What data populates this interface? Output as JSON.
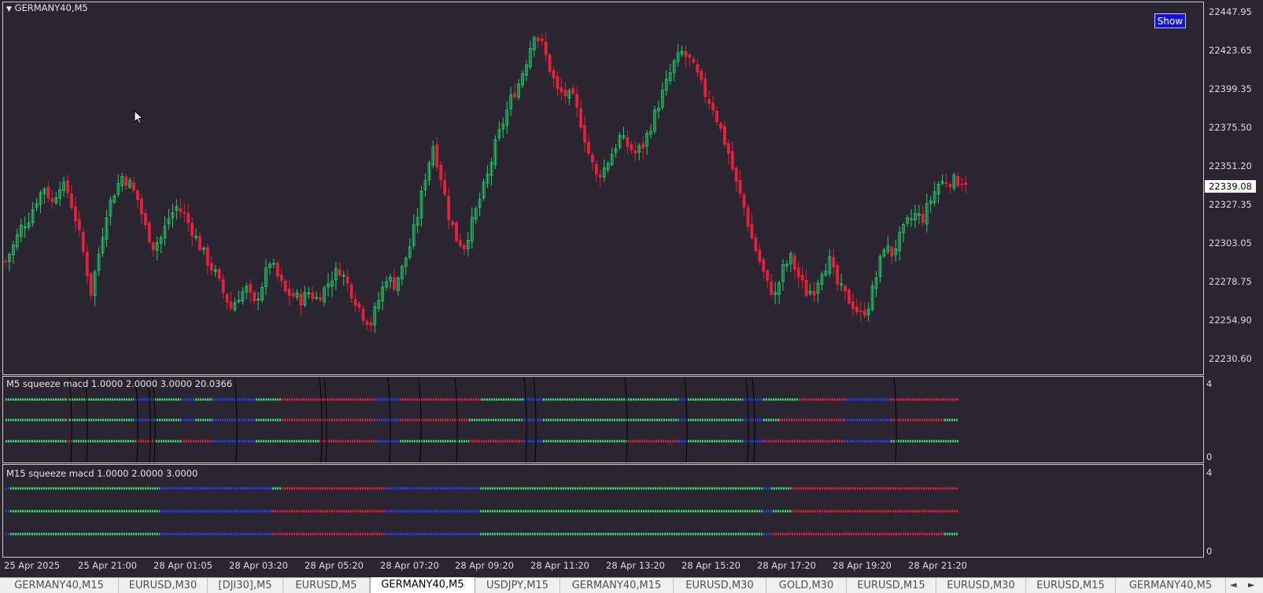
{
  "main_pane": {
    "symbol_label": "GERMANY40,M5",
    "show_button": "Show",
    "current_price": "22339.08",
    "price_labels": [
      "22447.95",
      "22423.65",
      "22399.35",
      "22375.50",
      "22351.20",
      "22327.35",
      "22303.05",
      "22278.75",
      "22254.90",
      "22230.60"
    ]
  },
  "indicator_m5": {
    "label": "M5 squeeze macd 1.0000 2.0000 3.0000 20.0366",
    "axis_max": "4",
    "axis_min": "0"
  },
  "indicator_m15": {
    "label": "M15 squeeze macd 1.0000 2.0000 3.0000",
    "axis_max": "4",
    "axis_min": "0"
  },
  "time_axis": [
    "25 Apr 2025",
    "25 Apr 21:00",
    "28 Apr 01:05",
    "28 Apr 03:20",
    "28 Apr 05:20",
    "28 Apr 07:20",
    "28 Apr 09:20",
    "28 Apr 11:20",
    "28 Apr 13:20",
    "28 Apr 15:20",
    "28 Apr 17:20",
    "28 Apr 19:20",
    "28 Apr 21:20"
  ],
  "tabs": [
    {
      "label": "GERMANY40,M15",
      "active": false
    },
    {
      "label": "EURUSD,M30",
      "active": false
    },
    {
      "label": "[DJI30],M5",
      "active": false
    },
    {
      "label": "EURUSD,M5",
      "active": false
    },
    {
      "label": "GERMANY40,M5",
      "active": true
    },
    {
      "label": "USDJPY,M15",
      "active": false
    },
    {
      "label": "GERMANY40,M15",
      "active": false
    },
    {
      "label": "EURUSD,M30",
      "active": false
    },
    {
      "label": "GOLD,M30",
      "active": false
    },
    {
      "label": "EURUSD,M15",
      "active": false
    },
    {
      "label": "EURUSD,M30",
      "active": false
    },
    {
      "label": "EURUSD,M15",
      "active": false
    },
    {
      "label": "GERMANY40,M5",
      "active": false
    }
  ],
  "colors": {
    "background": "#2a2530",
    "bull_candle": "#1fd36a",
    "bear_candle": "#e8203a",
    "squeeze_on": "#2a3ef5",
    "squeeze_green": "#24e870",
    "squeeze_red": "#e02040",
    "text": "#e6e6e6"
  },
  "chart_data": {
    "type": "candlestick",
    "symbol": "GERMANY40",
    "timeframe": "M5",
    "ylim": [
      22220,
      22455
    ],
    "close_path": [
      [
        0,
        22290
      ],
      [
        4,
        22300
      ],
      [
        8,
        22312
      ],
      [
        12,
        22318
      ],
      [
        16,
        22330
      ],
      [
        20,
        22338
      ],
      [
        24,
        22328
      ],
      [
        28,
        22340
      ],
      [
        32,
        22335
      ],
      [
        36,
        22318
      ],
      [
        40,
        22296
      ],
      [
        44,
        22270
      ],
      [
        48,
        22295
      ],
      [
        52,
        22322
      ],
      [
        56,
        22335
      ],
      [
        60,
        22345
      ],
      [
        64,
        22340
      ],
      [
        68,
        22330
      ],
      [
        72,
        22312
      ],
      [
        76,
        22300
      ],
      [
        80,
        22305
      ],
      [
        84,
        22318
      ],
      [
        88,
        22325
      ],
      [
        92,
        22320
      ],
      [
        96,
        22310
      ],
      [
        100,
        22300
      ],
      [
        104,
        22290
      ],
      [
        108,
        22282
      ],
      [
        112,
        22270
      ],
      [
        116,
        22260
      ],
      [
        120,
        22268
      ],
      [
        124,
        22272
      ],
      [
        128,
        22262
      ],
      [
        132,
        22275
      ],
      [
        136,
        22290
      ],
      [
        140,
        22280
      ],
      [
        144,
        22270
      ],
      [
        148,
        22268
      ],
      [
        152,
        22265
      ],
      [
        156,
        22270
      ],
      [
        160,
        22266
      ],
      [
        164,
        22272
      ],
      [
        168,
        22280
      ],
      [
        172,
        22285
      ],
      [
        176,
        22275
      ],
      [
        180,
        22265
      ],
      [
        184,
        22255
      ],
      [
        188,
        22250
      ],
      [
        192,
        22265
      ],
      [
        196,
        22280
      ],
      [
        200,
        22275
      ],
      [
        204,
        22285
      ],
      [
        208,
        22300
      ],
      [
        212,
        22320
      ],
      [
        216,
        22345
      ],
      [
        220,
        22365
      ],
      [
        224,
        22345
      ],
      [
        228,
        22320
      ],
      [
        232,
        22305
      ],
      [
        236,
        22300
      ],
      [
        240,
        22315
      ],
      [
        244,
        22330
      ],
      [
        248,
        22345
      ],
      [
        252,
        22365
      ],
      [
        256,
        22380
      ],
      [
        260,
        22395
      ],
      [
        264,
        22405
      ],
      [
        268,
        22420
      ],
      [
        272,
        22438
      ],
      [
        276,
        22430
      ],
      [
        280,
        22415
      ],
      [
        284,
        22400
      ],
      [
        288,
        22398
      ],
      [
        292,
        22395
      ],
      [
        296,
        22380
      ],
      [
        300,
        22360
      ],
      [
        304,
        22345
      ],
      [
        308,
        22350
      ],
      [
        312,
        22360
      ],
      [
        316,
        22370
      ],
      [
        320,
        22365
      ],
      [
        324,
        22360
      ],
      [
        328,
        22365
      ],
      [
        332,
        22378
      ],
      [
        336,
        22392
      ],
      [
        340,
        22405
      ],
      [
        344,
        22418
      ],
      [
        348,
        22425
      ],
      [
        352,
        22420
      ],
      [
        356,
        22410
      ],
      [
        360,
        22398
      ],
      [
        364,
        22390
      ],
      [
        368,
        22375
      ],
      [
        372,
        22360
      ],
      [
        376,
        22340
      ],
      [
        380,
        22325
      ],
      [
        384,
        22305
      ],
      [
        388,
        22290
      ],
      [
        392,
        22275
      ],
      [
        396,
        22268
      ],
      [
        400,
        22285
      ],
      [
        404,
        22292
      ],
      [
        408,
        22280
      ],
      [
        412,
        22270
      ],
      [
        416,
        22272
      ],
      [
        420,
        22285
      ],
      [
        424,
        22290
      ],
      [
        428,
        22275
      ],
      [
        432,
        22268
      ],
      [
        436,
        22262
      ],
      [
        440,
        22255
      ],
      [
        444,
        22262
      ],
      [
        448,
        22280
      ],
      [
        452,
        22300
      ],
      [
        456,
        22295
      ],
      [
        460,
        22305
      ],
      [
        464,
        22315
      ],
      [
        468,
        22320
      ],
      [
        472,
        22318
      ],
      [
        476,
        22330
      ],
      [
        480,
        22340
      ],
      [
        484,
        22342
      ]
    ],
    "indicator_panels": [
      {
        "name": "M5 squeeze macd",
        "params": "1.0000 2.0000 3.0000 20.0366",
        "ylim": [
          0,
          4
        ],
        "rows": 3
      },
      {
        "name": "M15 squeeze macd",
        "params": "1.0000 2.0000 3.0000",
        "ylim": [
          0,
          4
        ],
        "rows": 3
      }
    ]
  }
}
